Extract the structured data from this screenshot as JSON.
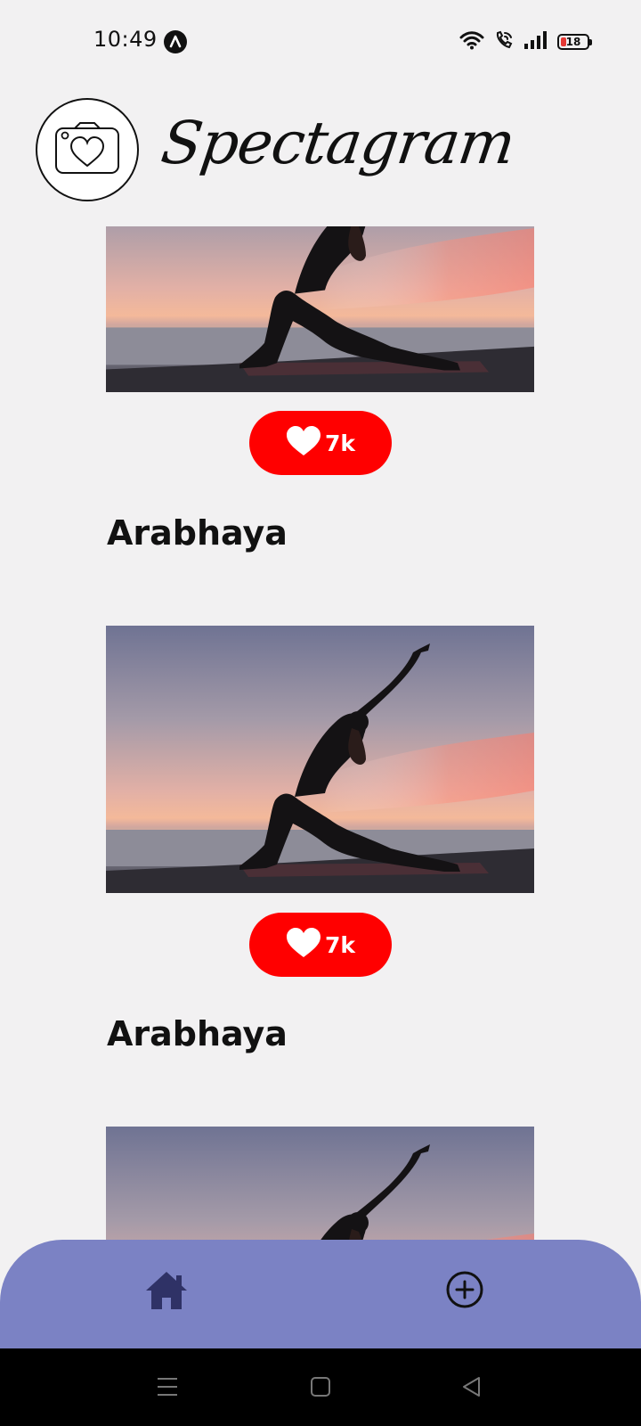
{
  "status_bar": {
    "time": "10:49",
    "battery_level": "18",
    "icons": [
      "alert-badge-icon",
      "wifi-icon",
      "wifi-calling-icon",
      "signal-icon",
      "battery-icon"
    ]
  },
  "header": {
    "brand_name": "Spectagram",
    "logo_icon": "camera-heart-icon"
  },
  "feed": {
    "posts": [
      {
        "title": "Arabhaya",
        "likes": "7k",
        "image": "yoga-sunset-photo"
      },
      {
        "title": "Arabhaya",
        "likes": "7k",
        "image": "yoga-sunset-photo"
      },
      {
        "title": "",
        "likes": "",
        "image": "yoga-sunset-photo"
      }
    ]
  },
  "bottom_nav": {
    "items": [
      {
        "icon": "home-icon"
      },
      {
        "icon": "add-circle-icon"
      }
    ]
  },
  "system_nav": {
    "items": [
      "menu-icon",
      "home-square-icon",
      "back-triangle-icon"
    ]
  },
  "colors": {
    "background": "#f2f1f2",
    "like_button": "#ff0000",
    "bottom_nav": "#7b82c4",
    "home_icon": "#2f3266"
  }
}
